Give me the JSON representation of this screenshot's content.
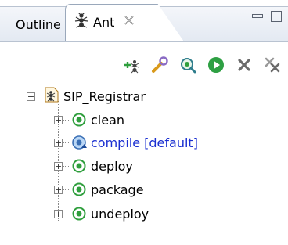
{
  "tabs": [
    {
      "label": "Outline",
      "active": false
    },
    {
      "label": "Ant",
      "active": true,
      "icon": "ant-icon",
      "close_icon": "close-icon"
    }
  ],
  "view_controls": {
    "minimize_icon": "minimize-icon",
    "maximize_icon": "maximize-icon"
  },
  "toolbar": {
    "buttons": [
      {
        "name": "add-buildfiles-button",
        "icon": "add-ant-icon"
      },
      {
        "name": "add-buildfiles-with-search-button",
        "icon": "wrench-search-icon"
      },
      {
        "name": "hide-internal-targets-button",
        "icon": "filter-icon"
      },
      {
        "name": "run-selected-target-button",
        "icon": "run-icon"
      },
      {
        "name": "remove-button",
        "icon": "remove-icon"
      },
      {
        "name": "remove-all-button",
        "icon": "remove-all-icon"
      }
    ]
  },
  "tree": {
    "root": {
      "label": "SIP_Registrar",
      "icon": "ant-buildfile-icon",
      "expanded": true
    },
    "targets": [
      {
        "label": "clean",
        "icon": "target-icon",
        "default": false
      },
      {
        "label": "compile [default]",
        "icon": "default-target-icon",
        "default": true
      },
      {
        "label": "deploy",
        "icon": "target-icon",
        "default": false
      },
      {
        "label": "package",
        "icon": "target-icon",
        "default": false
      },
      {
        "label": "undeploy",
        "icon": "target-icon",
        "default": false
      }
    ]
  },
  "colors": {
    "default_target": "#1a2fd1",
    "target_green": "#2e9e3c",
    "tab_border": "#9aa8bb"
  }
}
